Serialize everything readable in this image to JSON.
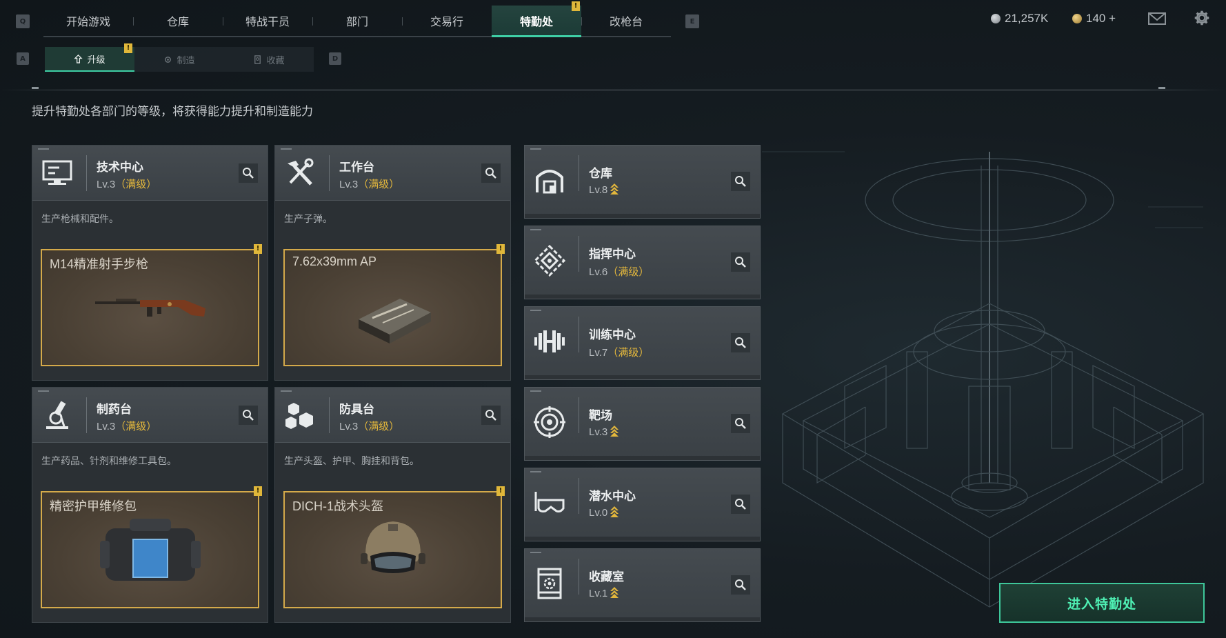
{
  "nav": {
    "left_key": "Q",
    "right_key": "E",
    "tabs": [
      {
        "label": "开始游戏"
      },
      {
        "label": "仓库"
      },
      {
        "label": "特战干员"
      },
      {
        "label": "部门"
      },
      {
        "label": "交易行"
      },
      {
        "label": "特勤处",
        "active": true,
        "notification": "!"
      },
      {
        "label": "改枪台"
      }
    ]
  },
  "currency": {
    "primary": "21,257K",
    "secondary": "140 +"
  },
  "top_icons": [
    "mail-icon",
    "gear-icon"
  ],
  "subnav": {
    "left_key": "A",
    "right_key": "D",
    "tabs": [
      {
        "label": "升级",
        "icon": "upgrade-icon",
        "active": true,
        "notification": "!"
      },
      {
        "label": "制造",
        "icon": "manufacture-icon"
      },
      {
        "label": "收藏",
        "icon": "collection-icon"
      }
    ]
  },
  "description": "提升特勤处各部门的等级，将获得能力提升和制造能力",
  "departments": [
    {
      "title": "技术中心",
      "level": "Lv.3",
      "status": "（满级）",
      "icon": "monitor-icon",
      "desc": "生产枪械和配件。",
      "item": "M14精准射手步枪",
      "item_icon": "rifle-image",
      "notification": "!"
    },
    {
      "title": "工作台",
      "level": "Lv.3",
      "status": "（满级）",
      "icon": "tools-icon",
      "desc": "生产子弹。",
      "item": "7.62x39mm AP",
      "item_icon": "ammo-box-image",
      "notification": "!"
    },
    {
      "title": "制药台",
      "level": "Lv.3",
      "status": "（满级）",
      "icon": "microscope-icon",
      "desc": "生产药品、针剂和维修工具包。",
      "item": "精密护甲维修包",
      "item_icon": "repair-kit-image",
      "notification": "!"
    },
    {
      "title": "防具台",
      "level": "Lv.3",
      "status": "（满级）",
      "icon": "cubes-icon",
      "desc": "生产头盔、护甲、胸挂和背包。",
      "item": "DICH-1战术头盔",
      "item_icon": "helmet-image",
      "notification": "!"
    }
  ],
  "facilities": [
    {
      "title": "仓库",
      "level": "Lv.8",
      "status": "",
      "icon": "warehouse-icon",
      "upgradable": true
    },
    {
      "title": "指挥中心",
      "level": "Lv.6",
      "status": "（满级）",
      "icon": "command-icon",
      "upgradable": false
    },
    {
      "title": "训练中心",
      "level": "Lv.7",
      "status": "（满级）",
      "icon": "dumbbell-icon",
      "upgradable": false
    },
    {
      "title": "靶场",
      "level": "Lv.3",
      "status": "",
      "icon": "target-icon",
      "upgradable": true
    },
    {
      "title": "潜水中心",
      "level": "Lv.0",
      "status": "",
      "icon": "goggles-icon",
      "upgradable": true
    },
    {
      "title": "收藏室",
      "level": "Lv.1",
      "status": "",
      "icon": "collection-room-icon",
      "upgradable": true
    }
  ],
  "enter_button": "进入特勤处",
  "colors": {
    "accent": "#3fd0a6",
    "maxed": "#e3b73c",
    "item_border": "#d5aa4a"
  }
}
